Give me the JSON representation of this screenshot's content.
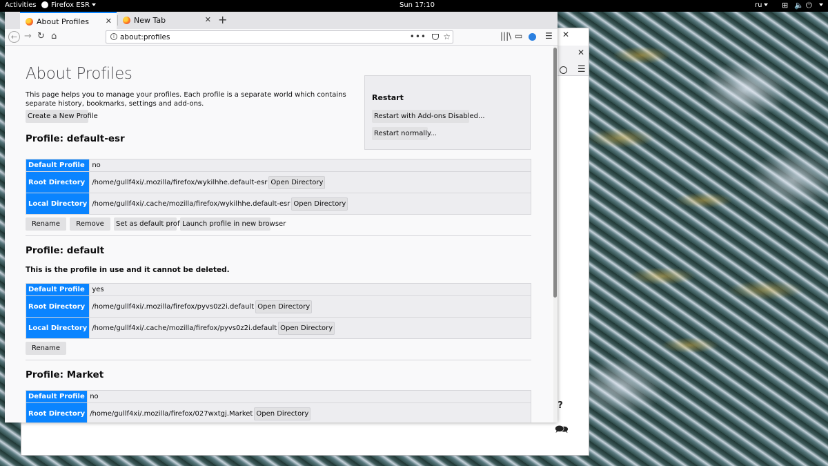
{
  "topbar": {
    "activities": "Activities",
    "app_name": "Firefox ESR",
    "clock": "Sun 17:10",
    "keyboard_layout": "ru"
  },
  "tabs": [
    {
      "label": "About Profiles",
      "active": true
    },
    {
      "label": "New Tab",
      "active": false
    }
  ],
  "navbar": {
    "url": "about:profiles"
  },
  "page": {
    "title": "About Profiles",
    "intro": "This page helps you to manage your profiles. Each profile is a separate world which contains separate history, bookmarks, settings and add-ons.",
    "create_button": "Create a New Profile",
    "restart": {
      "title": "Restart",
      "with_addons_disabled": "Restart with Add-ons Disabled...",
      "normally": "Restart normally..."
    },
    "labels": {
      "default_profile": "Default Profile",
      "root_directory": "Root Directory",
      "local_directory": "Local Directory",
      "open_directory": "Open Directory",
      "rename": "Rename",
      "remove": "Remove",
      "set_default": "Set as default profile",
      "launch": "Launch profile in new browser"
    },
    "profiles": [
      {
        "heading": "Profile: default-esr",
        "default_profile": "no",
        "root_directory": "/home/gullf4xi/.mozilla/firefox/wykilhhe.default-esr",
        "local_directory": "/home/gullf4xi/.cache/mozilla/firefox/wykilhhe.default-esr"
      },
      {
        "heading": "Profile: default",
        "in_use_note": "This is the profile in use and it cannot be deleted.",
        "default_profile": "yes",
        "root_directory": "/home/gullf4xi/.mozilla/firefox/pyvs0z2i.default",
        "local_directory": "/home/gullf4xi/.cache/mozilla/firefox/pyvs0z2i.default"
      },
      {
        "heading": "Profile: Market",
        "default_profile": "no",
        "root_directory": "/home/gullf4xi/.mozilla/firefox/027wxtgj.Market"
      }
    ]
  }
}
